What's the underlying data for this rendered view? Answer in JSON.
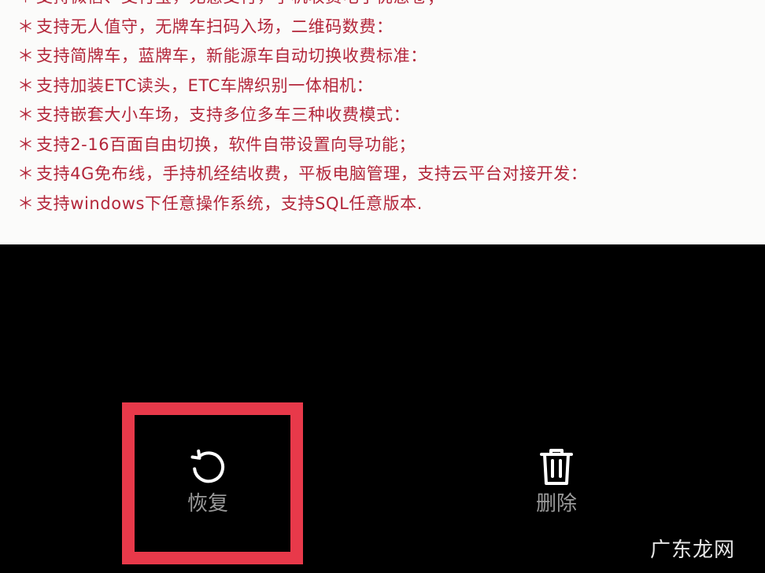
{
  "features": {
    "bullet": "＊",
    "lines": [
      "支持微信、支付宝，无感支付，手机收费电子优惠卷；",
      "支持无人值守，无牌车扫码入场，二维码数费：",
      "支持简牌车，蓝牌车，新能源车自动切换收费标准：",
      "支持加装ETC读头，ETC车牌织别一体相机：",
      "支持嵌套大小车场，支持多位多车三种收费模式：",
      "支持2-16百面自由切换，软件自带设置向导功能；",
      "支持4G免布线，手持机经结收费，平板电脑管理，支持云平台对接开发：",
      "支持windows下任意操作系统，支持SQL任意版本."
    ]
  },
  "actions": {
    "restore": {
      "label": "恢复",
      "icon": "restore-icon"
    },
    "delete": {
      "label": "删除",
      "icon": "trash-icon"
    }
  },
  "highlight_color": "#e8394a",
  "watermark": "广东龙网"
}
